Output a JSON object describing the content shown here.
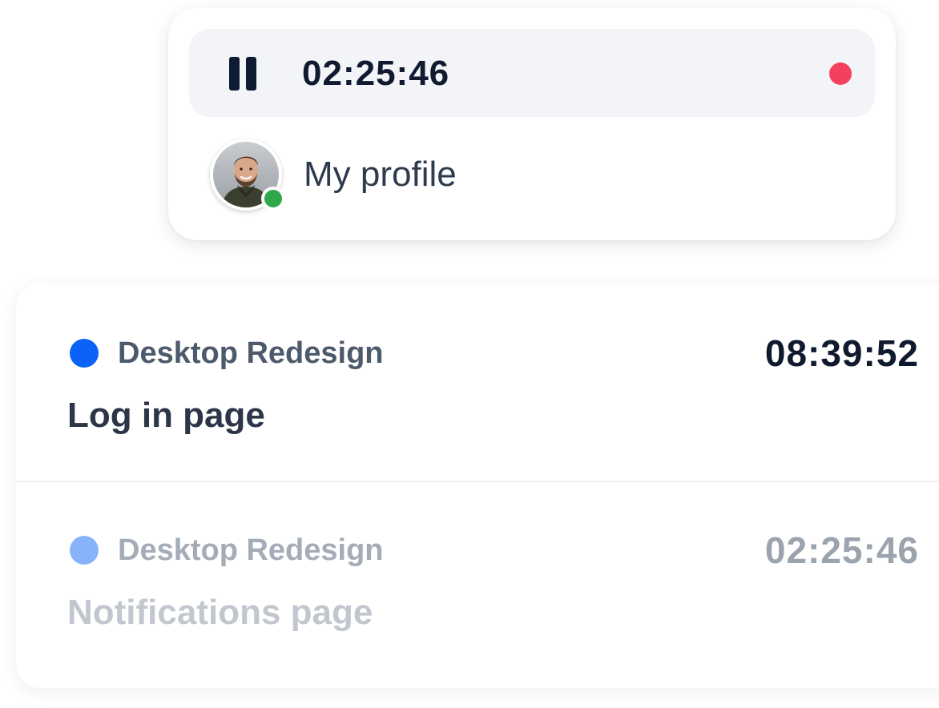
{
  "timer": {
    "current_time": "02:25:46",
    "pause_icon": "pause-icon",
    "recording_indicator_color": "#f43f5e"
  },
  "profile": {
    "label": "My profile",
    "avatar_icon": "user-avatar",
    "status": "online",
    "status_color": "#2ea84a"
  },
  "tasks": [
    {
      "project": "Desktop Redesign",
      "project_color": "#0a63f6",
      "name": "Log in page",
      "time": "08:39:52"
    },
    {
      "project": "Desktop Redesign",
      "project_color": "#87b3fb",
      "name": "Notifications page",
      "time": "02:25:46"
    }
  ]
}
